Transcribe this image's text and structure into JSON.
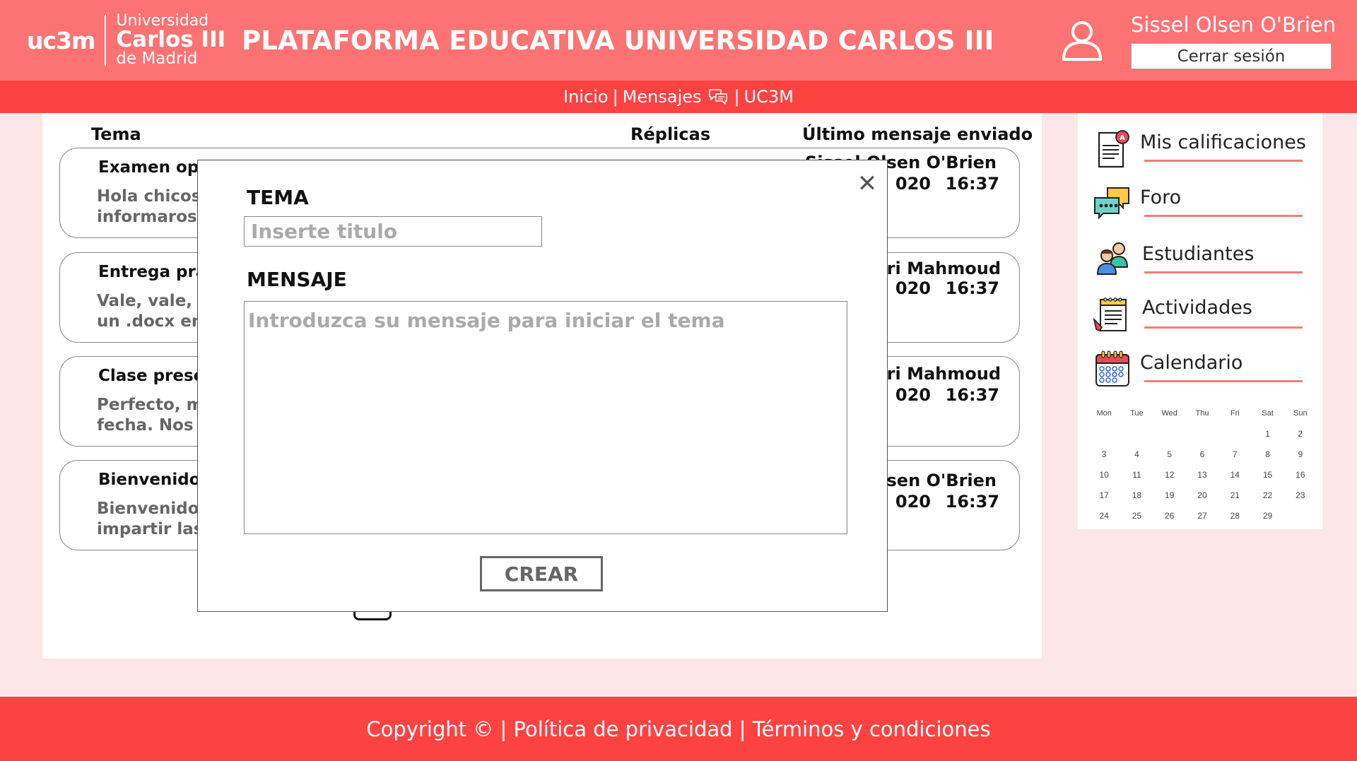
{
  "header": {
    "logo": {
      "brand": "uc3m",
      "line1": "Universidad",
      "line2": "Carlos III",
      "line3": "de Madrid"
    },
    "title": "PLATAFORMA EDUCATIVA UNIVERSIDAD CARLOS III",
    "user_name": "Sissel Olsen O'Brien",
    "logout_label": "Cerrar sesión"
  },
  "nav": {
    "home": "Inicio",
    "sep1": "|",
    "messages": "Mensajes",
    "sep2": "|",
    "org": "UC3M"
  },
  "forum": {
    "columns": {
      "topic": "Tema",
      "replies": "Réplicas",
      "last_message": "Último mensaje enviado"
    },
    "threads": [
      {
        "title": "Examen opc",
        "preview_1": "Hola chicos",
        "preview_2": "informaros c",
        "author": "Sissel Olsen O'Brien",
        "date": "020",
        "time": "16:37"
      },
      {
        "title": "Entrega prá",
        "preview_1": "Vale, vale, p",
        "preview_2": "un .docx en",
        "author": "kri Mahmoud",
        "date": "020",
        "time": "16:37"
      },
      {
        "title": "Clase prese",
        "preview_1": "Perfecto, m",
        "preview_2": "fecha. Nos v",
        "author": "kri Mahmoud",
        "date": "020",
        "time": "16:37"
      },
      {
        "title": "Bienvenidos",
        "preview_1": "Bienvenidos",
        "preview_2": "impartir las",
        "author": "Olsen O'Brien",
        "date": "020",
        "time": "16:37"
      }
    ]
  },
  "sidebar": {
    "items": [
      {
        "label": "Mis calificaciones",
        "icon": "grades-icon"
      },
      {
        "label": "Foro",
        "icon": "forum-chat-icon"
      },
      {
        "label": "Estudiantes",
        "icon": "students-icon"
      },
      {
        "label": "Actividades",
        "icon": "activities-notepad-icon"
      },
      {
        "label": "Calendario",
        "icon": "calendar-icon"
      }
    ],
    "calendar": {
      "weekdays": [
        "Mon",
        "Tue",
        "Wed",
        "Thu",
        "Fri",
        "Sat",
        "Sun"
      ],
      "weeks": [
        [
          "",
          "",
          "",
          "",
          "",
          "1",
          "2"
        ],
        [
          "3",
          "4",
          "5",
          "6",
          "7",
          "8",
          "9"
        ],
        [
          "10",
          "11",
          "12",
          "13",
          "14",
          "15",
          "16"
        ],
        [
          "17",
          "18",
          "19",
          "20",
          "21",
          "22",
          "23"
        ],
        [
          "24",
          "25",
          "26",
          "27",
          "28",
          "29",
          ""
        ]
      ]
    }
  },
  "modal": {
    "close_symbol": "✕",
    "topic_label": "TEMA",
    "topic_placeholder": "Inserte titulo",
    "message_label": "MENSAJE",
    "message_placeholder": "Introduzca su mensaje para iniciar el tema",
    "create_label": "CREAR"
  },
  "footer": {
    "text": "Copyright © | Política de privacidad | Términos y condiciones"
  },
  "colors": {
    "header_bg": "#fd7272",
    "nav_bg": "#fd4242",
    "page_bg": "#fde6e7",
    "accent_line": "#f47b7b"
  }
}
